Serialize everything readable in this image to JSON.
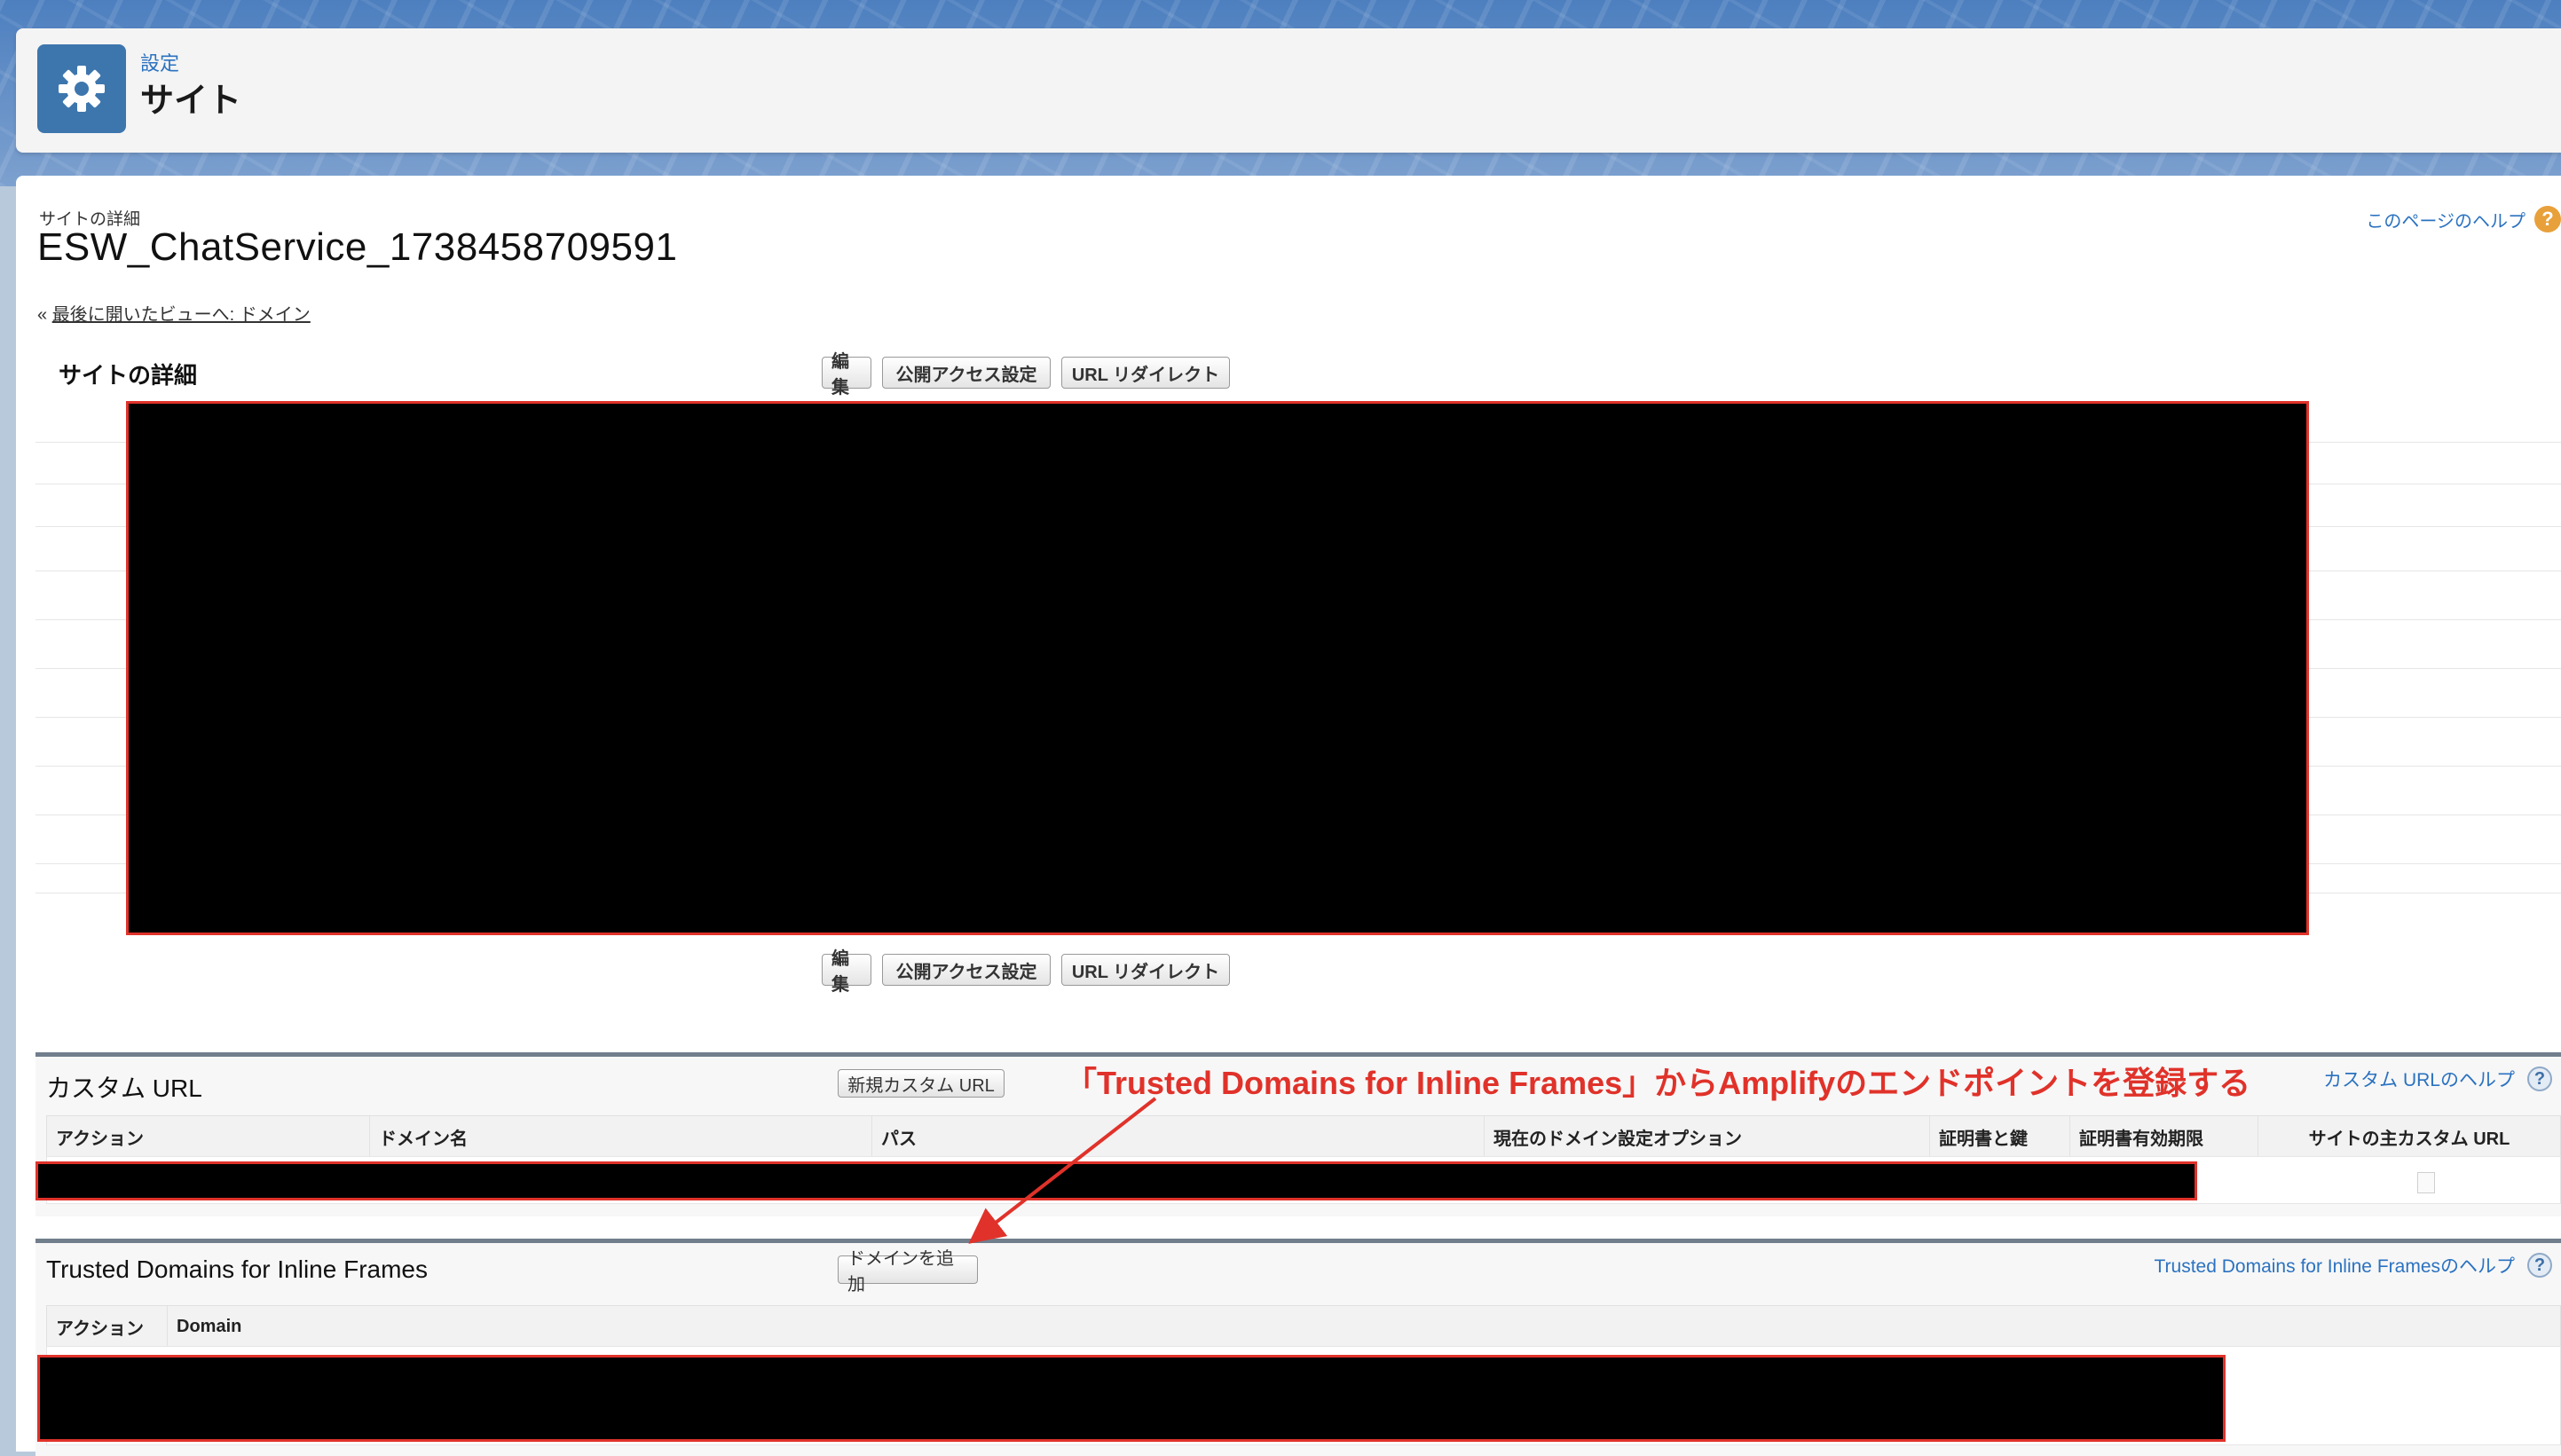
{
  "header": {
    "breadcrumb": "設定",
    "title": "サイト",
    "icon": "gear-icon"
  },
  "page": {
    "detail_label": "サイトの詳細",
    "site_name": "ESW_ChatService_1738458709591",
    "help_link": "このページのヘルプ",
    "back_prefix": "«",
    "back_link": "最後に開いたビューへ: ドメイン"
  },
  "site_detail": {
    "title": "サイトの詳細",
    "buttons": [
      "編集",
      "公開アクセス設定",
      "URL リダイレクト"
    ]
  },
  "custom_url": {
    "title": "カスタム URL",
    "new_button": "新規カスタム URL",
    "help_link": "カスタム URLのヘルプ",
    "columns": [
      "アクション",
      "ドメイン名",
      "パス",
      "現在のドメイン設定オプション",
      "証明書と鍵",
      "証明書有効期限",
      "サイトの主カスタム URL"
    ]
  },
  "trusted_domains": {
    "title": "Trusted Domains for Inline Frames",
    "add_button": "ドメインを追加",
    "help_link": "Trusted Domains for Inline Framesのヘルプ",
    "columns": [
      "アクション",
      "Domain"
    ]
  },
  "annotation": {
    "text": "「Trusted Domains for Inline Frames」からAmplifyのエンドポイントを登録する",
    "color": "#e0322a"
  },
  "colors": {
    "link": "#2b72c0",
    "header_icon_bg": "#3d76ad",
    "redaction_border": "#e0322a"
  }
}
